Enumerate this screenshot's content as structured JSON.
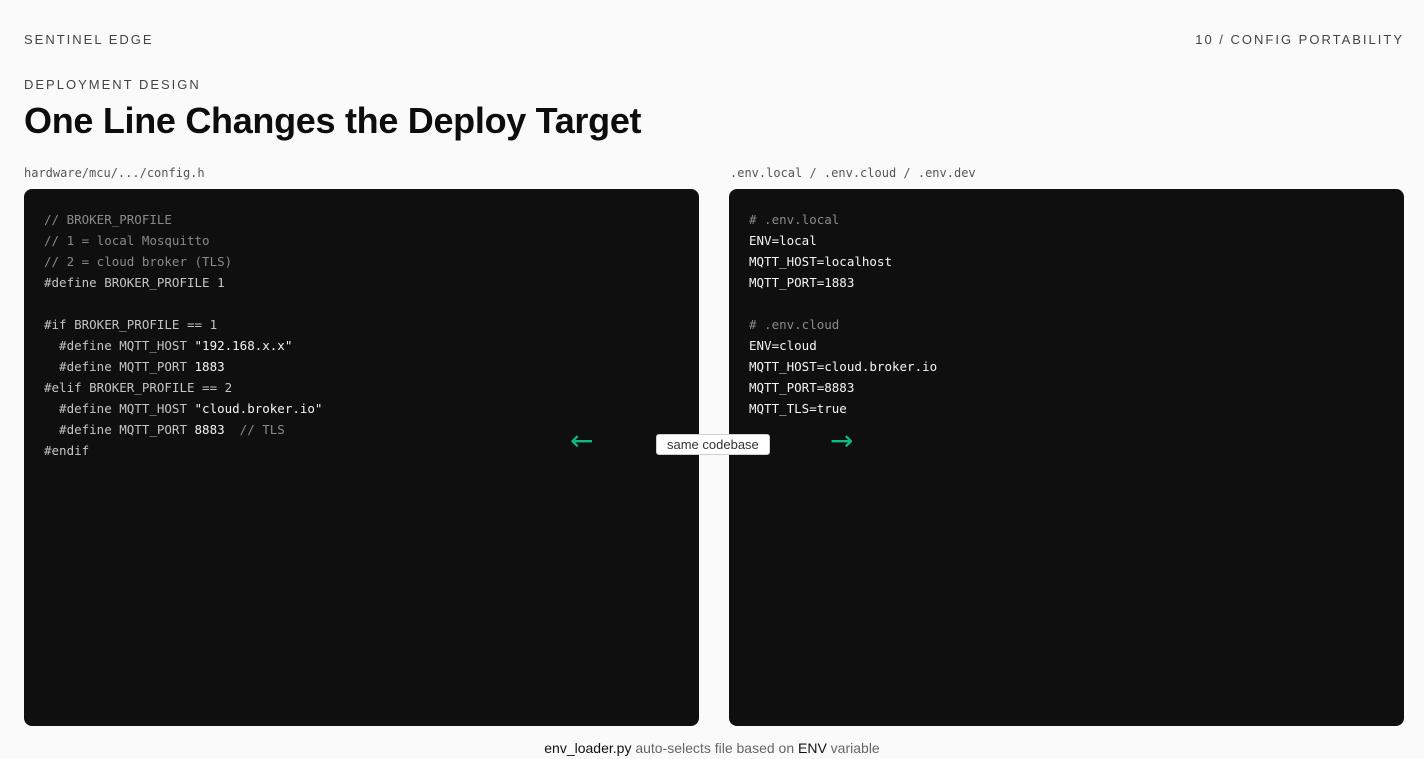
{
  "header": {
    "brand": "SENTINEL EDGE",
    "slide_index": "10 / CONFIG PORTABILITY"
  },
  "section": {
    "eyebrow": "DEPLOYMENT DESIGN",
    "title": "One Line Changes the Deploy Target"
  },
  "left_pane": {
    "label": "hardware/mcu/.../config.h",
    "lines": [
      {
        "segments": [
          {
            "t": "// BROKER_PROFILE",
            "s": "c"
          }
        ]
      },
      {
        "segments": [
          {
            "t": "// 1 = local Mosquitto",
            "s": "c"
          }
        ]
      },
      {
        "segments": [
          {
            "t": "// 2 = cloud broker (TLS)",
            "s": "c"
          }
        ]
      },
      {
        "segments": [
          {
            "t": "#define BROKER_PROFILE 1",
            "s": "k"
          }
        ]
      },
      {
        "segments": []
      },
      {
        "segments": [
          {
            "t": "#if BROKER_PROFILE == 1",
            "s": "k"
          }
        ]
      },
      {
        "segments": [
          {
            "t": "  #define MQTT_HOST ",
            "s": "k"
          },
          {
            "t": "\"192.168.x.x\"",
            "s": "v"
          }
        ]
      },
      {
        "segments": [
          {
            "t": "  #define MQTT_PORT ",
            "s": "k"
          },
          {
            "t": "1883",
            "s": "v"
          }
        ]
      },
      {
        "segments": [
          {
            "t": "#elif BROKER_PROFILE == 2",
            "s": "k"
          }
        ]
      },
      {
        "segments": [
          {
            "t": "  #define MQTT_HOST ",
            "s": "k"
          },
          {
            "t": "\"cloud.broker.io\"",
            "s": "v"
          }
        ]
      },
      {
        "segments": [
          {
            "t": "  #define MQTT_PORT ",
            "s": "k"
          },
          {
            "t": "8883",
            "s": "v"
          },
          {
            "t": "  // TLS",
            "s": "c"
          }
        ]
      },
      {
        "segments": [
          {
            "t": "#endif",
            "s": "k"
          }
        ]
      }
    ]
  },
  "right_pane": {
    "label": ".env.local / .env.cloud / .env.dev",
    "lines": [
      {
        "segments": [
          {
            "t": "# .env.local",
            "s": "c"
          }
        ]
      },
      {
        "segments": [
          {
            "t": "ENV=local",
            "s": "v"
          }
        ]
      },
      {
        "segments": [
          {
            "t": "MQTT_HOST=localhost",
            "s": "v"
          }
        ]
      },
      {
        "segments": [
          {
            "t": "MQTT_PORT=1883",
            "s": "v"
          }
        ]
      },
      {
        "segments": []
      },
      {
        "segments": [
          {
            "t": "# .env.cloud",
            "s": "c"
          }
        ]
      },
      {
        "segments": [
          {
            "t": "ENV=cloud",
            "s": "v"
          }
        ]
      },
      {
        "segments": [
          {
            "t": "MQTT_HOST=cloud.broker.io",
            "s": "v"
          }
        ]
      },
      {
        "segments": [
          {
            "t": "MQTT_PORT=8883",
            "s": "v"
          }
        ]
      },
      {
        "segments": [
          {
            "t": "MQTT_TLS=true",
            "s": "v"
          }
        ]
      }
    ]
  },
  "connector": {
    "badge": "same codebase",
    "left_arrow": "←",
    "right_arrow": "→",
    "arrow_color": "#10b981"
  },
  "footer": {
    "file": "env_loader.py",
    "mid": " auto-selects file based on ",
    "var": "ENV",
    "end": " variable"
  }
}
